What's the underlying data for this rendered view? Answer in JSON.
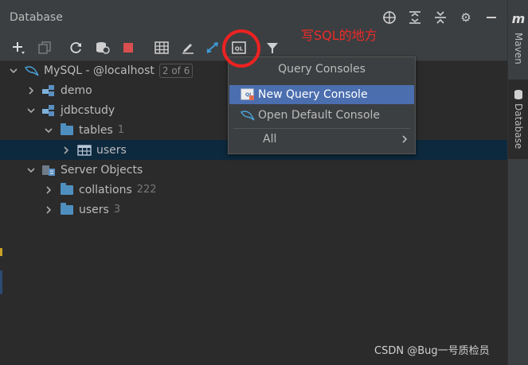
{
  "header": {
    "title": "Database"
  },
  "tree": {
    "rows": [
      {
        "label": "MySQL - @localhost",
        "badge": "2 of 6"
      },
      {
        "label": "demo"
      },
      {
        "label": "jdbcstudy"
      },
      {
        "label": "tables",
        "count": "1"
      },
      {
        "label": "users"
      },
      {
        "label": "Server Objects"
      },
      {
        "label": "collations",
        "count": "222"
      },
      {
        "label": "users",
        "count": "3"
      }
    ]
  },
  "menu": {
    "title": "Query Consoles",
    "items": [
      {
        "label": "New Query Console"
      },
      {
        "label": "Open Default Console"
      },
      {
        "label": "All"
      }
    ]
  },
  "right_bar": {
    "maven": "Maven",
    "database": "Database"
  },
  "annotation": {
    "text": "写SQL的地方"
  },
  "watermark": "CSDN @Bug一号质检员",
  "colors": {
    "accent": "#4b6eaf",
    "annotation": "#ee2222",
    "selected_row": "#0d293e"
  }
}
